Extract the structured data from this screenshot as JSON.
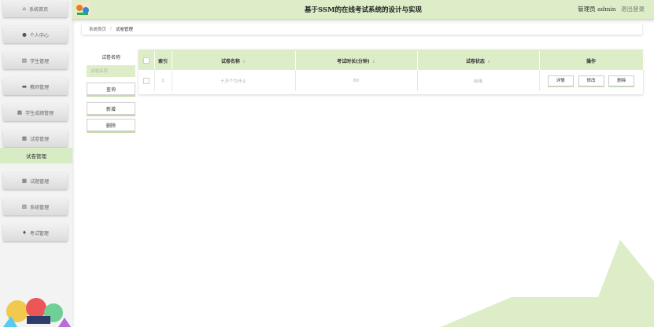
{
  "app": {
    "title": "基于SSM的在线考试系统的设计与实现",
    "user_label": "管理员 admin",
    "logout_label": "退出登录"
  },
  "sidebar": {
    "items": [
      {
        "label": "系统首页",
        "icon": "home-icon"
      },
      {
        "label": "个人中心",
        "icon": "user-icon"
      },
      {
        "label": "学生管理",
        "icon": "file-icon"
      },
      {
        "label": "教师管理",
        "icon": "id-card-icon"
      },
      {
        "label": "学生成绩管理",
        "icon": "grid-icon"
      },
      {
        "label": "试卷管理",
        "icon": "grid-icon"
      },
      {
        "label": "试题管理",
        "icon": "grid-icon"
      },
      {
        "label": "系统管理",
        "icon": "file-icon"
      },
      {
        "label": "考试管理",
        "icon": "bell-icon"
      }
    ],
    "active_sub_label": "试卷管理"
  },
  "breadcrumb": {
    "home": "系统首页",
    "current": "试卷管理"
  },
  "filter": {
    "label": "试卷名称",
    "placeholder": "试卷名称",
    "search_label": "查询",
    "add_label": "新增",
    "delete_label": "删除"
  },
  "table": {
    "columns": [
      "索引",
      "试卷名称",
      "考试时长(分钟)",
      "试卷状态",
      "操作"
    ],
    "rows": [
      {
        "index": "1",
        "name": "十万个为什么",
        "duration": "60",
        "status": "启用"
      }
    ],
    "actions": {
      "detail": "详情",
      "edit": "修改",
      "delete": "删除"
    }
  },
  "colors": {
    "accent": "#dcedc8",
    "accent_dark": "#c3dcaa"
  }
}
